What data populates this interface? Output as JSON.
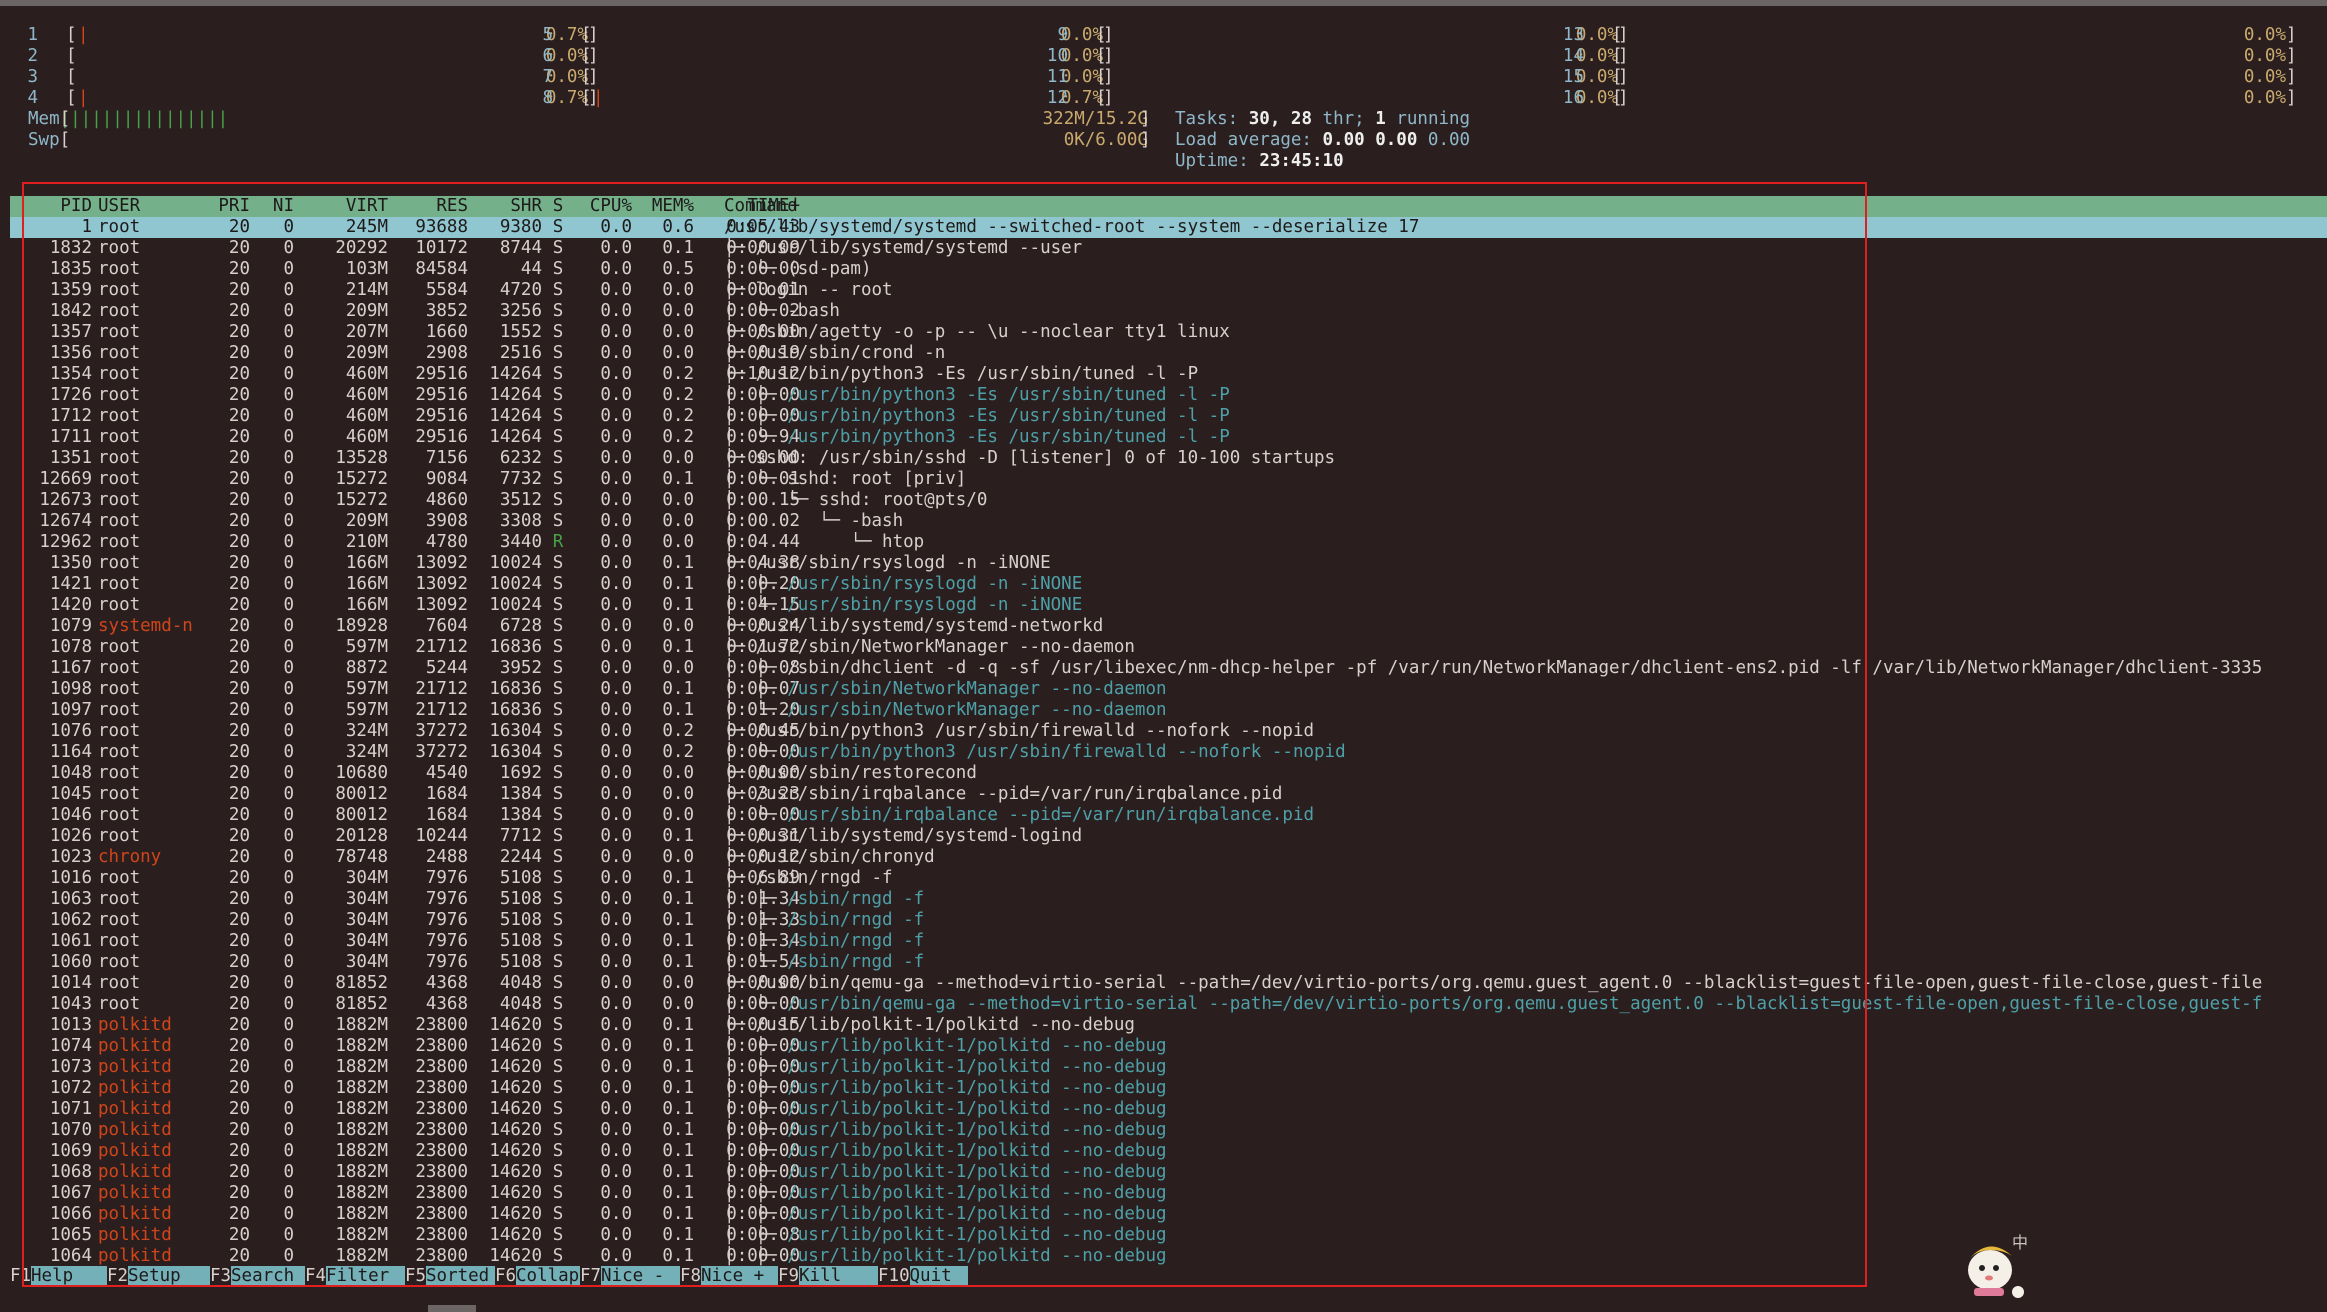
{
  "cpus": [
    {
      "num": "1",
      "bar": "|",
      "value": "0.7%"
    },
    {
      "num": "2",
      "bar": "",
      "value": "0.0%"
    },
    {
      "num": "3",
      "bar": "",
      "value": "0.0%"
    },
    {
      "num": "4",
      "bar": "|",
      "value": "0.7%"
    },
    {
      "num": "5",
      "bar": "",
      "value": "0.0%"
    },
    {
      "num": "6",
      "bar": "",
      "value": "0.0%"
    },
    {
      "num": "7",
      "bar": "",
      "value": "0.0%"
    },
    {
      "num": "8",
      "bar": "|",
      "value": "0.7%"
    },
    {
      "num": "9",
      "bar": "",
      "value": "0.0%"
    },
    {
      "num": "10",
      "bar": "",
      "value": "0.0%"
    },
    {
      "num": "11",
      "bar": "",
      "value": "0.0%"
    },
    {
      "num": "12",
      "bar": "",
      "value": "0.0%"
    },
    {
      "num": "13",
      "bar": "",
      "value": "0.0%"
    },
    {
      "num": "14",
      "bar": "",
      "value": "0.0%"
    },
    {
      "num": "15",
      "bar": "",
      "value": "0.0%"
    },
    {
      "num": "16",
      "bar": "",
      "value": "0.0%"
    }
  ],
  "memory": {
    "label": "Mem",
    "bar": "||||||||||||||||",
    "value": "322M/15.2G"
  },
  "swap": {
    "label": "Swp",
    "bar": "",
    "value": "0K/6.00G"
  },
  "summary": {
    "tasks_label": "Tasks:",
    "tasks": "30,",
    "threads": "28",
    "threads_label": "thr;",
    "running": "1",
    "running_label": "running",
    "load_label": "Load average:",
    "load1": "0.00",
    "load5": "0.00",
    "load15": "0.00",
    "uptime_label": "Uptime:",
    "uptime": "23:45:10"
  },
  "columns": {
    "pid": "PID",
    "user": "USER",
    "pri": "PRI",
    "ni": "NI",
    "virt": "VIRT",
    "res": "RES",
    "shr": "SHR",
    "s": "S",
    "cpu": "CPU%",
    "mem": "MEM%",
    "time": "TIME+",
    "cmd": "Command"
  },
  "processes": [
    {
      "pid": "1",
      "user": "root",
      "pri": "20",
      "ni": "0",
      "virt": "245M",
      "res": "93688",
      "shr": "9380",
      "s": "S",
      "cpu": "0.0",
      "mem": "0.6",
      "time": "0:05.43",
      "tree": "",
      "cmd": "/usr/lib/systemd/systemd --switched-root --system --deserialize 17",
      "thread": false,
      "selected": true
    },
    {
      "pid": "1832",
      "user": "root",
      "pri": "20",
      "ni": "0",
      "virt": "20292",
      "res": "10172",
      "shr": "8744",
      "s": "S",
      "cpu": "0.0",
      "mem": "0.1",
      "time": "0:00.09",
      "tree": "├─ ",
      "cmd": "/usr/lib/systemd/systemd --user",
      "thread": false
    },
    {
      "pid": "1835",
      "user": "root",
      "pri": "20",
      "ni": "0",
      "virt": "103M",
      "res": "84584",
      "shr": "44",
      "s": "S",
      "cpu": "0.0",
      "mem": "0.5",
      "time": "0:00.00",
      "tree": "│  └─ ",
      "cmd": "(sd-pam)",
      "thread": false
    },
    {
      "pid": "1359",
      "user": "root",
      "pri": "20",
      "ni": "0",
      "virt": "214M",
      "res": "5584",
      "shr": "4720",
      "s": "S",
      "cpu": "0.0",
      "mem": "0.0",
      "time": "0:00.01",
      "tree": "├─ ",
      "cmd": "login -- root",
      "thread": false
    },
    {
      "pid": "1842",
      "user": "root",
      "pri": "20",
      "ni": "0",
      "virt": "209M",
      "res": "3852",
      "shr": "3256",
      "s": "S",
      "cpu": "0.0",
      "mem": "0.0",
      "time": "0:00.02",
      "tree": "│  └─ ",
      "cmd": "-bash",
      "thread": false
    },
    {
      "pid": "1357",
      "user": "root",
      "pri": "20",
      "ni": "0",
      "virt": "207M",
      "res": "1660",
      "shr": "1552",
      "s": "S",
      "cpu": "0.0",
      "mem": "0.0",
      "time": "0:00.00",
      "tree": "├─ ",
      "cmd": "/sbin/agetty -o -p -- \\u --noclear tty1 linux",
      "thread": false
    },
    {
      "pid": "1356",
      "user": "root",
      "pri": "20",
      "ni": "0",
      "virt": "209M",
      "res": "2908",
      "shr": "2516",
      "s": "S",
      "cpu": "0.0",
      "mem": "0.0",
      "time": "0:00.19",
      "tree": "├─ ",
      "cmd": "/usr/sbin/crond -n",
      "thread": false
    },
    {
      "pid": "1354",
      "user": "root",
      "pri": "20",
      "ni": "0",
      "virt": "460M",
      "res": "29516",
      "shr": "14264",
      "s": "S",
      "cpu": "0.0",
      "mem": "0.2",
      "time": "0:10.12",
      "tree": "├─ ",
      "cmd": "/usr/bin/python3 -Es /usr/sbin/tuned -l -P",
      "thread": false
    },
    {
      "pid": "1726",
      "user": "root",
      "pri": "20",
      "ni": "0",
      "virt": "460M",
      "res": "29516",
      "shr": "14264",
      "s": "S",
      "cpu": "0.0",
      "mem": "0.2",
      "time": "0:00.00",
      "tree": "│  ├─ ",
      "cmd": "/usr/bin/python3 -Es /usr/sbin/tuned -l -P",
      "thread": true
    },
    {
      "pid": "1712",
      "user": "root",
      "pri": "20",
      "ni": "0",
      "virt": "460M",
      "res": "29516",
      "shr": "14264",
      "s": "S",
      "cpu": "0.0",
      "mem": "0.2",
      "time": "0:00.00",
      "tree": "│  ├─ ",
      "cmd": "/usr/bin/python3 -Es /usr/sbin/tuned -l -P",
      "thread": true
    },
    {
      "pid": "1711",
      "user": "root",
      "pri": "20",
      "ni": "0",
      "virt": "460M",
      "res": "29516",
      "shr": "14264",
      "s": "S",
      "cpu": "0.0",
      "mem": "0.2",
      "time": "0:09.94",
      "tree": "│  └─ ",
      "cmd": "/usr/bin/python3 -Es /usr/sbin/tuned -l -P",
      "thread": true
    },
    {
      "pid": "1351",
      "user": "root",
      "pri": "20",
      "ni": "0",
      "virt": "13528",
      "res": "7156",
      "shr": "6232",
      "s": "S",
      "cpu": "0.0",
      "mem": "0.0",
      "time": "0:00.00",
      "tree": "├─ ",
      "cmd": "sshd: /usr/sbin/sshd -D [listener] 0 of 10-100 startups",
      "thread": false
    },
    {
      "pid": "12669",
      "user": "root",
      "pri": "20",
      "ni": "0",
      "virt": "15272",
      "res": "9084",
      "shr": "7732",
      "s": "S",
      "cpu": "0.0",
      "mem": "0.1",
      "time": "0:00.01",
      "tree": "│  └─ ",
      "cmd": "sshd: root [priv]",
      "thread": false
    },
    {
      "pid": "12673",
      "user": "root",
      "pri": "20",
      "ni": "0",
      "virt": "15272",
      "res": "4860",
      "shr": "3512",
      "s": "S",
      "cpu": "0.0",
      "mem": "0.0",
      "time": "0:00.15",
      "tree": "│     └─ ",
      "cmd": "sshd: root@pts/0",
      "thread": false
    },
    {
      "pid": "12674",
      "user": "root",
      "pri": "20",
      "ni": "0",
      "virt": "209M",
      "res": "3908",
      "shr": "3308",
      "s": "S",
      "cpu": "0.0",
      "mem": "0.0",
      "time": "0:00.02",
      "tree": "│        └─ ",
      "cmd": "-bash",
      "thread": false
    },
    {
      "pid": "12962",
      "user": "root",
      "pri": "20",
      "ni": "0",
      "virt": "210M",
      "res": "4780",
      "shr": "3440",
      "s": "R",
      "cpu": "0.0",
      "mem": "0.0",
      "time": "0:04.44",
      "tree": "│           └─ ",
      "cmd": "htop",
      "thread": false
    },
    {
      "pid": "1350",
      "user": "root",
      "pri": "20",
      "ni": "0",
      "virt": "166M",
      "res": "13092",
      "shr": "10024",
      "s": "S",
      "cpu": "0.0",
      "mem": "0.1",
      "time": "0:04.38",
      "tree": "├─ ",
      "cmd": "/usr/sbin/rsyslogd -n -iNONE",
      "thread": false
    },
    {
      "pid": "1421",
      "user": "root",
      "pri": "20",
      "ni": "0",
      "virt": "166M",
      "res": "13092",
      "shr": "10024",
      "s": "S",
      "cpu": "0.0",
      "mem": "0.1",
      "time": "0:00.20",
      "tree": "│  ├─ ",
      "cmd": "/usr/sbin/rsyslogd -n -iNONE",
      "thread": true
    },
    {
      "pid": "1420",
      "user": "root",
      "pri": "20",
      "ni": "0",
      "virt": "166M",
      "res": "13092",
      "shr": "10024",
      "s": "S",
      "cpu": "0.0",
      "mem": "0.1",
      "time": "0:04.15",
      "tree": "│  └─ ",
      "cmd": "/usr/sbin/rsyslogd -n -iNONE",
      "thread": true
    },
    {
      "pid": "1079",
      "user": "systemd-n",
      "pri": "20",
      "ni": "0",
      "virt": "18928",
      "res": "7604",
      "shr": "6728",
      "s": "S",
      "cpu": "0.0",
      "mem": "0.0",
      "time": "0:00.24",
      "tree": "├─ ",
      "cmd": "/usr/lib/systemd/systemd-networkd",
      "thread": false
    },
    {
      "pid": "1078",
      "user": "root",
      "pri": "20",
      "ni": "0",
      "virt": "597M",
      "res": "21712",
      "shr": "16836",
      "s": "S",
      "cpu": "0.0",
      "mem": "0.1",
      "time": "0:01.72",
      "tree": "├─ ",
      "cmd": "/usr/sbin/NetworkManager --no-daemon",
      "thread": false
    },
    {
      "pid": "1167",
      "user": "root",
      "pri": "20",
      "ni": "0",
      "virt": "8872",
      "res": "5244",
      "shr": "3952",
      "s": "S",
      "cpu": "0.0",
      "mem": "0.0",
      "time": "0:00.08",
      "tree": "│  ├─ ",
      "cmd": "/sbin/dhclient -d -q -sf /usr/libexec/nm-dhcp-helper -pf /var/run/NetworkManager/dhclient-ens2.pid -lf /var/lib/NetworkManager/dhclient-3335",
      "thread": false
    },
    {
      "pid": "1098",
      "user": "root",
      "pri": "20",
      "ni": "0",
      "virt": "597M",
      "res": "21712",
      "shr": "16836",
      "s": "S",
      "cpu": "0.0",
      "mem": "0.1",
      "time": "0:00.07",
      "tree": "│  ├─ ",
      "cmd": "/usr/sbin/NetworkManager --no-daemon",
      "thread": true
    },
    {
      "pid": "1097",
      "user": "root",
      "pri": "20",
      "ni": "0",
      "virt": "597M",
      "res": "21712",
      "shr": "16836",
      "s": "S",
      "cpu": "0.0",
      "mem": "0.1",
      "time": "0:01.20",
      "tree": "│  └─ ",
      "cmd": "/usr/sbin/NetworkManager --no-daemon",
      "thread": true
    },
    {
      "pid": "1076",
      "user": "root",
      "pri": "20",
      "ni": "0",
      "virt": "324M",
      "res": "37272",
      "shr": "16304",
      "s": "S",
      "cpu": "0.0",
      "mem": "0.2",
      "time": "0:00.45",
      "tree": "├─ ",
      "cmd": "/usr/bin/python3 /usr/sbin/firewalld --nofork --nopid",
      "thread": false
    },
    {
      "pid": "1164",
      "user": "root",
      "pri": "20",
      "ni": "0",
      "virt": "324M",
      "res": "37272",
      "shr": "16304",
      "s": "S",
      "cpu": "0.0",
      "mem": "0.2",
      "time": "0:00.00",
      "tree": "│  └─ ",
      "cmd": "/usr/bin/python3 /usr/sbin/firewalld --nofork --nopid",
      "thread": true
    },
    {
      "pid": "1048",
      "user": "root",
      "pri": "20",
      "ni": "0",
      "virt": "10680",
      "res": "4540",
      "shr": "1692",
      "s": "S",
      "cpu": "0.0",
      "mem": "0.0",
      "time": "0:00.00",
      "tree": "├─ ",
      "cmd": "/usr/sbin/restorecond",
      "thread": false
    },
    {
      "pid": "1045",
      "user": "root",
      "pri": "20",
      "ni": "0",
      "virt": "80012",
      "res": "1684",
      "shr": "1384",
      "s": "S",
      "cpu": "0.0",
      "mem": "0.0",
      "time": "0:03.23",
      "tree": "├─ ",
      "cmd": "/usr/sbin/irqbalance --pid=/var/run/irqbalance.pid",
      "thread": false
    },
    {
      "pid": "1046",
      "user": "root",
      "pri": "20",
      "ni": "0",
      "virt": "80012",
      "res": "1684",
      "shr": "1384",
      "s": "S",
      "cpu": "0.0",
      "mem": "0.0",
      "time": "0:00.00",
      "tree": "│  └─ ",
      "cmd": "/usr/sbin/irqbalance --pid=/var/run/irqbalance.pid",
      "thread": true
    },
    {
      "pid": "1026",
      "user": "root",
      "pri": "20",
      "ni": "0",
      "virt": "20128",
      "res": "10244",
      "shr": "7712",
      "s": "S",
      "cpu": "0.0",
      "mem": "0.1",
      "time": "0:00.31",
      "tree": "├─ ",
      "cmd": "/usr/lib/systemd/systemd-logind",
      "thread": false
    },
    {
      "pid": "1023",
      "user": "chrony",
      "pri": "20",
      "ni": "0",
      "virt": "78748",
      "res": "2488",
      "shr": "2244",
      "s": "S",
      "cpu": "0.0",
      "mem": "0.0",
      "time": "0:00.12",
      "tree": "├─ ",
      "cmd": "/usr/sbin/chronyd",
      "thread": false
    },
    {
      "pid": "1016",
      "user": "root",
      "pri": "20",
      "ni": "0",
      "virt": "304M",
      "res": "7976",
      "shr": "5108",
      "s": "S",
      "cpu": "0.0",
      "mem": "0.1",
      "time": "0:06.89",
      "tree": "├─ ",
      "cmd": "/sbin/rngd -f",
      "thread": false
    },
    {
      "pid": "1063",
      "user": "root",
      "pri": "20",
      "ni": "0",
      "virt": "304M",
      "res": "7976",
      "shr": "5108",
      "s": "S",
      "cpu": "0.0",
      "mem": "0.1",
      "time": "0:01.34",
      "tree": "│  ├─ ",
      "cmd": "/sbin/rngd -f",
      "thread": true
    },
    {
      "pid": "1062",
      "user": "root",
      "pri": "20",
      "ni": "0",
      "virt": "304M",
      "res": "7976",
      "shr": "5108",
      "s": "S",
      "cpu": "0.0",
      "mem": "0.1",
      "time": "0:01.33",
      "tree": "│  ├─ ",
      "cmd": "/sbin/rngd -f",
      "thread": true
    },
    {
      "pid": "1061",
      "user": "root",
      "pri": "20",
      "ni": "0",
      "virt": "304M",
      "res": "7976",
      "shr": "5108",
      "s": "S",
      "cpu": "0.0",
      "mem": "0.1",
      "time": "0:01.34",
      "tree": "│  ├─ ",
      "cmd": "/sbin/rngd -f",
      "thread": true
    },
    {
      "pid": "1060",
      "user": "root",
      "pri": "20",
      "ni": "0",
      "virt": "304M",
      "res": "7976",
      "shr": "5108",
      "s": "S",
      "cpu": "0.0",
      "mem": "0.1",
      "time": "0:01.54",
      "tree": "│  └─ ",
      "cmd": "/sbin/rngd -f",
      "thread": true
    },
    {
      "pid": "1014",
      "user": "root",
      "pri": "20",
      "ni": "0",
      "virt": "81852",
      "res": "4368",
      "shr": "4048",
      "s": "S",
      "cpu": "0.0",
      "mem": "0.0",
      "time": "0:00.00",
      "tree": "├─ ",
      "cmd": "/usr/bin/qemu-ga --method=virtio-serial --path=/dev/virtio-ports/org.qemu.guest_agent.0 --blacklist=guest-file-open,guest-file-close,guest-file",
      "thread": false
    },
    {
      "pid": "1043",
      "user": "root",
      "pri": "20",
      "ni": "0",
      "virt": "81852",
      "res": "4368",
      "shr": "4048",
      "s": "S",
      "cpu": "0.0",
      "mem": "0.0",
      "time": "0:00.00",
      "tree": "│  └─ ",
      "cmd": "/usr/bin/qemu-ga --method=virtio-serial --path=/dev/virtio-ports/org.qemu.guest_agent.0 --blacklist=guest-file-open,guest-file-close,guest-f",
      "thread": true
    },
    {
      "pid": "1013",
      "user": "polkitd",
      "pri": "20",
      "ni": "0",
      "virt": "1882M",
      "res": "23800",
      "shr": "14620",
      "s": "S",
      "cpu": "0.0",
      "mem": "0.1",
      "time": "0:00.15",
      "tree": "├─ ",
      "cmd": "/usr/lib/polkit-1/polkitd --no-debug",
      "thread": false
    },
    {
      "pid": "1074",
      "user": "polkitd",
      "pri": "20",
      "ni": "0",
      "virt": "1882M",
      "res": "23800",
      "shr": "14620",
      "s": "S",
      "cpu": "0.0",
      "mem": "0.1",
      "time": "0:00.00",
      "tree": "│  ├─ ",
      "cmd": "/usr/lib/polkit-1/polkitd --no-debug",
      "thread": true
    },
    {
      "pid": "1073",
      "user": "polkitd",
      "pri": "20",
      "ni": "0",
      "virt": "1882M",
      "res": "23800",
      "shr": "14620",
      "s": "S",
      "cpu": "0.0",
      "mem": "0.1",
      "time": "0:00.00",
      "tree": "│  ├─ ",
      "cmd": "/usr/lib/polkit-1/polkitd --no-debug",
      "thread": true
    },
    {
      "pid": "1072",
      "user": "polkitd",
      "pri": "20",
      "ni": "0",
      "virt": "1882M",
      "res": "23800",
      "shr": "14620",
      "s": "S",
      "cpu": "0.0",
      "mem": "0.1",
      "time": "0:00.00",
      "tree": "│  ├─ ",
      "cmd": "/usr/lib/polkit-1/polkitd --no-debug",
      "thread": true
    },
    {
      "pid": "1071",
      "user": "polkitd",
      "pri": "20",
      "ni": "0",
      "virt": "1882M",
      "res": "23800",
      "shr": "14620",
      "s": "S",
      "cpu": "0.0",
      "mem": "0.1",
      "time": "0:00.00",
      "tree": "│  ├─ ",
      "cmd": "/usr/lib/polkit-1/polkitd --no-debug",
      "thread": true
    },
    {
      "pid": "1070",
      "user": "polkitd",
      "pri": "20",
      "ni": "0",
      "virt": "1882M",
      "res": "23800",
      "shr": "14620",
      "s": "S",
      "cpu": "0.0",
      "mem": "0.1",
      "time": "0:00.00",
      "tree": "│  ├─ ",
      "cmd": "/usr/lib/polkit-1/polkitd --no-debug",
      "thread": true
    },
    {
      "pid": "1069",
      "user": "polkitd",
      "pri": "20",
      "ni": "0",
      "virt": "1882M",
      "res": "23800",
      "shr": "14620",
      "s": "S",
      "cpu": "0.0",
      "mem": "0.1",
      "time": "0:00.00",
      "tree": "│  ├─ ",
      "cmd": "/usr/lib/polkit-1/polkitd --no-debug",
      "thread": true
    },
    {
      "pid": "1068",
      "user": "polkitd",
      "pri": "20",
      "ni": "0",
      "virt": "1882M",
      "res": "23800",
      "shr": "14620",
      "s": "S",
      "cpu": "0.0",
      "mem": "0.1",
      "time": "0:00.00",
      "tree": "│  ├─ ",
      "cmd": "/usr/lib/polkit-1/polkitd --no-debug",
      "thread": true
    },
    {
      "pid": "1067",
      "user": "polkitd",
      "pri": "20",
      "ni": "0",
      "virt": "1882M",
      "res": "23800",
      "shr": "14620",
      "s": "S",
      "cpu": "0.0",
      "mem": "0.1",
      "time": "0:00.00",
      "tree": "│  ├─ ",
      "cmd": "/usr/lib/polkit-1/polkitd --no-debug",
      "thread": true
    },
    {
      "pid": "1066",
      "user": "polkitd",
      "pri": "20",
      "ni": "0",
      "virt": "1882M",
      "res": "23800",
      "shr": "14620",
      "s": "S",
      "cpu": "0.0",
      "mem": "0.1",
      "time": "0:00.00",
      "tree": "│  ├─ ",
      "cmd": "/usr/lib/polkit-1/polkitd --no-debug",
      "thread": true
    },
    {
      "pid": "1065",
      "user": "polkitd",
      "pri": "20",
      "ni": "0",
      "virt": "1882M",
      "res": "23800",
      "shr": "14620",
      "s": "S",
      "cpu": "0.0",
      "mem": "0.1",
      "time": "0:00.08",
      "tree": "│  ├─ ",
      "cmd": "/usr/lib/polkit-1/polkitd --no-debug",
      "thread": true
    },
    {
      "pid": "1064",
      "user": "polkitd",
      "pri": "20",
      "ni": "0",
      "virt": "1882M",
      "res": "23800",
      "shr": "14620",
      "s": "S",
      "cpu": "0.0",
      "mem": "0.1",
      "time": "0:00.00",
      "tree": "│  ├─ ",
      "cmd": "/usr/lib/polkit-1/polkitd --no-debug",
      "thread": true
    }
  ],
  "function_keys": [
    {
      "key": "F1",
      "label": "Help"
    },
    {
      "key": "F2",
      "label": "Setup"
    },
    {
      "key": "F3",
      "label": "Search"
    },
    {
      "key": "F4",
      "label": "Filter"
    },
    {
      "key": "F5",
      "label": "Sorted"
    },
    {
      "key": "F6",
      "label": "Collap"
    },
    {
      "key": "F7",
      "label": "Nice -"
    },
    {
      "key": "F8",
      "label": "Nice +"
    },
    {
      "key": "F9",
      "label": "Kill"
    },
    {
      "key": "F10",
      "label": "Quit"
    }
  ],
  "overlay": {
    "mascot_char": "中"
  },
  "colors": {
    "background": "#2a1f1e",
    "header_bg": "#74b08a",
    "selected_bg": "#8fc6cf",
    "thread_fg": "#4ea0a8",
    "user_other_fg": "#d0451a",
    "meter_value_fg": "#c9a96e",
    "label_fg": "#8fb7c9",
    "highlight_border": "#e02020"
  }
}
